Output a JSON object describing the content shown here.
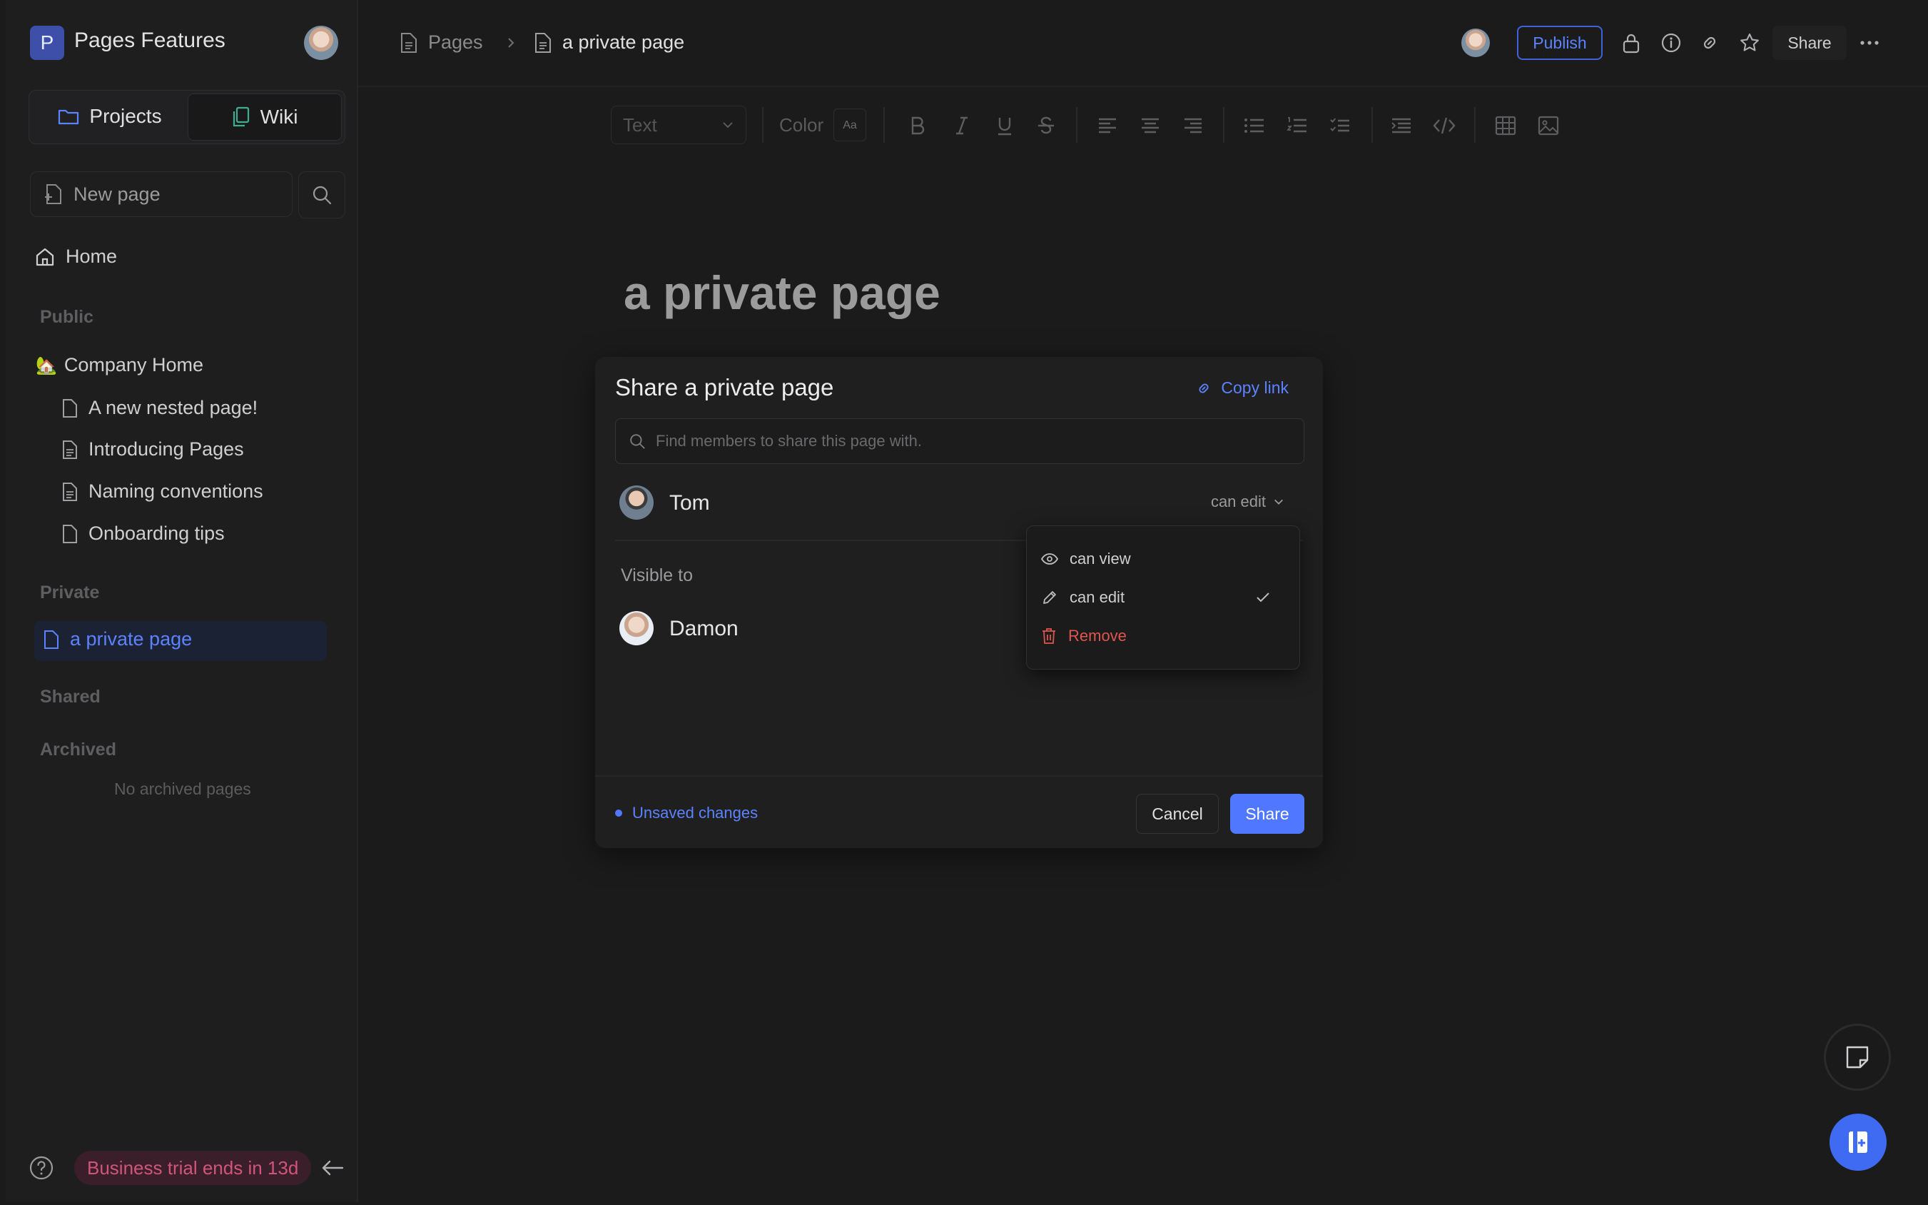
{
  "sidebar": {
    "workspace_initial": "P",
    "workspace_name": "Pages Features",
    "tabs": [
      {
        "label": "Projects"
      },
      {
        "label": "Wiki"
      }
    ],
    "new_page_label": "New page",
    "home_label": "Home",
    "sections": {
      "public": "Public",
      "private": "Private",
      "shared": "Shared",
      "archived": "Archived"
    },
    "public_pages": [
      {
        "label": "Company Home",
        "emoji": "🏡"
      },
      {
        "label": "A new nested page!"
      },
      {
        "label": "Introducing Pages"
      },
      {
        "label": "Naming conventions"
      },
      {
        "label": "Onboarding tips"
      }
    ],
    "private_pages": [
      {
        "label": "a private page"
      }
    ],
    "archived_empty": "No archived pages",
    "trial_badge": "Business trial ends in 13d"
  },
  "topbar": {
    "breadcrumb_root": "Pages",
    "breadcrumb_current": "a private page",
    "publish_label": "Publish",
    "share_label": "Share"
  },
  "toolbar": {
    "text_style": "Text",
    "color_label": "Color",
    "color_glyph": "Aa"
  },
  "document": {
    "title": "a private page"
  },
  "share_modal": {
    "title": "Share a private page",
    "copy_link": "Copy link",
    "search_placeholder": "Find members to share this page with.",
    "member": {
      "name": "Tom",
      "permission": "can edit"
    },
    "visible_to_label": "Visible to",
    "visible_member": {
      "name": "Damon"
    },
    "unsaved": "Unsaved changes",
    "cancel_label": "Cancel",
    "share_label": "Share"
  },
  "permission_menu": {
    "items": [
      {
        "label": "can view",
        "icon": "eye-icon"
      },
      {
        "label": "can edit",
        "icon": "pencil-icon",
        "selected": true
      },
      {
        "label": "Remove",
        "icon": "trash-icon"
      }
    ]
  },
  "colors": {
    "accent": "#4f77ff",
    "danger": "#e0554f",
    "trial_text": "#d0557a",
    "background": "#1b1b1c"
  }
}
